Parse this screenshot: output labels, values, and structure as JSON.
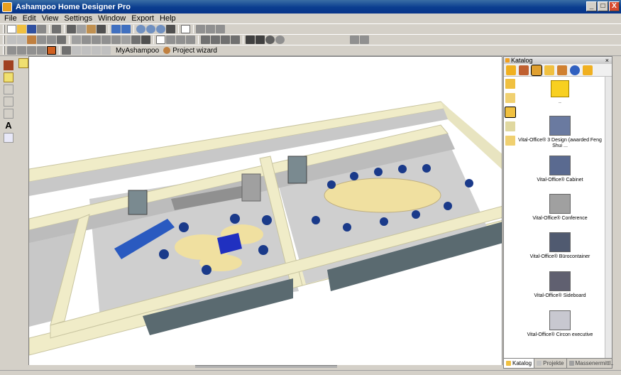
{
  "window": {
    "title": "Ashampoo Home Designer Pro",
    "btn_min": "_",
    "btn_max": "□",
    "btn_close": "X"
  },
  "menu": {
    "items": [
      "File",
      "Edit",
      "View",
      "Settings",
      "Window",
      "Export",
      "Help"
    ]
  },
  "tabs": {
    "myashampoo": "MyAshampoo",
    "wizard": "Project wizard"
  },
  "toolbar_icons": [
    "new-icon",
    "open-icon",
    "save-icon",
    "print-icon",
    "cut-icon",
    "copy-icon",
    "paste-icon",
    "delete-icon",
    "undo-icon",
    "redo-icon",
    "zoom-icon",
    "zoom-in-icon",
    "zoom-out-icon",
    "zoom-fit-icon"
  ],
  "catalog": {
    "header": "Katalog",
    "close": "×",
    "up_label": "..",
    "items": [
      {
        "label": "Vital-Office® 3 Design (awarded Feng Shui ..."
      },
      {
        "label": "Vital-Office® Cabinet"
      },
      {
        "label": "Vital-Office®  Conference"
      },
      {
        "label": "Vital-Office® Bürocontainer"
      },
      {
        "label": "Vital-Office®  Sideboard"
      },
      {
        "label": "Vital-Office® Circon executive"
      }
    ],
    "tabs": [
      "Katalog",
      "Projekte",
      "Massenermittl..."
    ]
  },
  "colors": {
    "accent": "#0a3d8f",
    "folder": "#f0b020",
    "wall_top": "#f0ecc8",
    "floor": "#c8c8c8",
    "chair": "#1a3a8a"
  }
}
